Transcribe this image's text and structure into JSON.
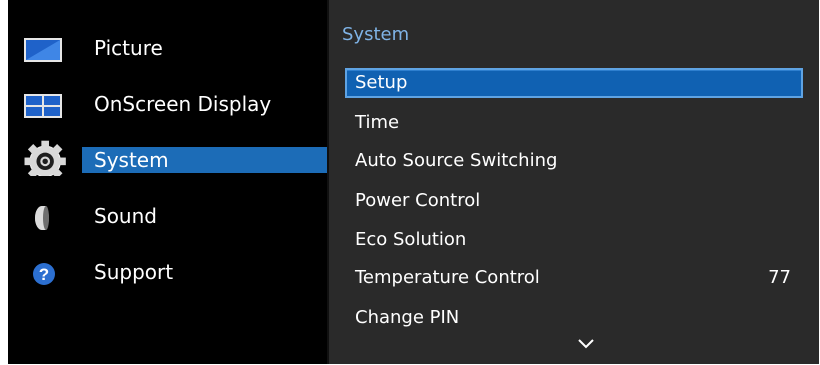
{
  "left_menu": {
    "items": [
      {
        "label": "Picture",
        "icon": "picture-icon"
      },
      {
        "label": "OnScreen Display",
        "icon": "onscreen-display-icon"
      },
      {
        "label": "System",
        "icon": "gear-icon",
        "selected": true
      },
      {
        "label": "Sound",
        "icon": "speaker-icon"
      },
      {
        "label": "Support",
        "icon": "help-icon"
      }
    ]
  },
  "panel": {
    "title": "System",
    "items": [
      {
        "label": "Setup",
        "selected": true
      },
      {
        "label": "Time"
      },
      {
        "label": "Auto Source Switching"
      },
      {
        "label": "Power Control"
      },
      {
        "label": "Eco Solution"
      },
      {
        "label": "Temperature Control",
        "value": "77"
      },
      {
        "label": "Change PIN"
      }
    ],
    "more_icon": "chevron-down-icon"
  },
  "colors": {
    "highlight": "#1c6cb7",
    "panel_bg": "#2a2a2a",
    "title": "#7fb3e6"
  }
}
